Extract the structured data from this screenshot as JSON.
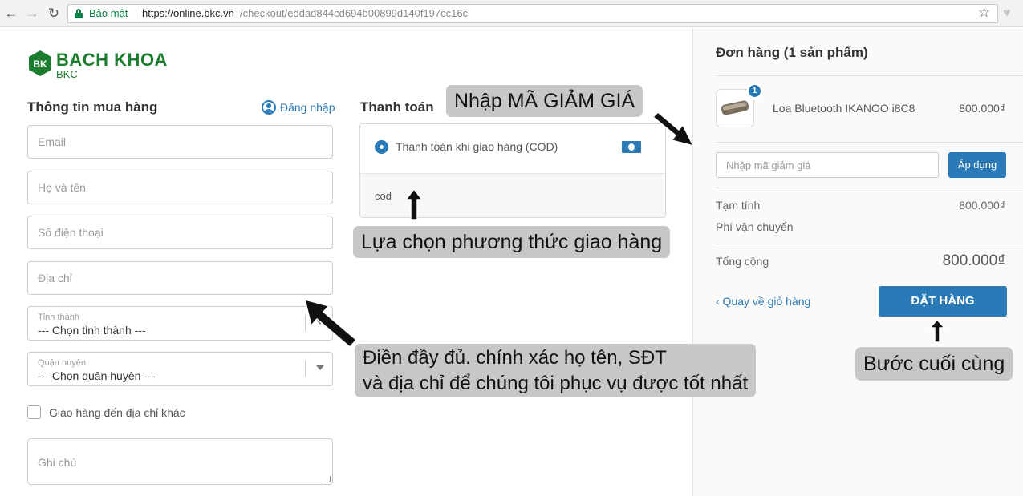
{
  "browser": {
    "back_icon": "←",
    "forward_icon": "→",
    "reload_icon": "↻",
    "secure_label": "Bảo mật",
    "url_host": "https://online.bkc.vn",
    "url_path": "/checkout/eddad844cd694b00899d140f197cc16c",
    "star_icon": "☆",
    "extension_icon": "♥"
  },
  "brand": {
    "mark": "BK",
    "name": "BACH KHOA",
    "sub": "BKC",
    "color": "#1a7e2e"
  },
  "purchase_info": {
    "title": "Thông tin mua hàng",
    "login_label": "Đăng nhập",
    "email_placeholder": "Email",
    "name_placeholder": "Họ và tên",
    "phone_placeholder": "Số điện thoại",
    "address_placeholder": "Địa chỉ",
    "province": {
      "label": "Tỉnh thành",
      "value": "--- Chọn tỉnh thành ---"
    },
    "district": {
      "label": "Quận huyện",
      "value": "--- Chọn quận huyện ---"
    },
    "other_address_label": "Giao hàng đến địa chỉ khác",
    "note_placeholder": "Ghi chú"
  },
  "payment": {
    "title": "Thanh toán",
    "option_label": "Thanh toán khi giao hàng (COD)",
    "option_description": "cod"
  },
  "order": {
    "title": "Đơn hàng (1 sản phẩm)",
    "item": {
      "quantity": "1",
      "name": "Loa Bluetooth IKANOO i8C8",
      "price": "800.000₫"
    },
    "discount_placeholder": "Nhập mã giảm giá",
    "apply_label": "Áp dụng",
    "subtotal_label": "Tạm tính",
    "subtotal_value": "800.000₫",
    "shipping_label": "Phí vận chuyển",
    "total_label": "Tổng cộng",
    "total_value": "800.000₫",
    "back_label": "‹ Quay về giỏ hàng",
    "submit_label": "ĐẶT HÀNG"
  },
  "annotations": {
    "discount_hint": "Nhập MÃ GIẢM GIÁ",
    "shipping_hint": "Lựa chọn phương thức giao hàng",
    "fill_hint_line1": "Điền đầy đủ. chính xác họ tên, SĐT",
    "fill_hint_line2": "và địa chỉ để chúng tôi phục vụ được tốt nhất",
    "final_step_hint": "Bước cuối cùng"
  },
  "colors": {
    "accent": "#2a7ab8",
    "secure_green": "#0b8043",
    "callout_bg": "#c7c7c7"
  }
}
